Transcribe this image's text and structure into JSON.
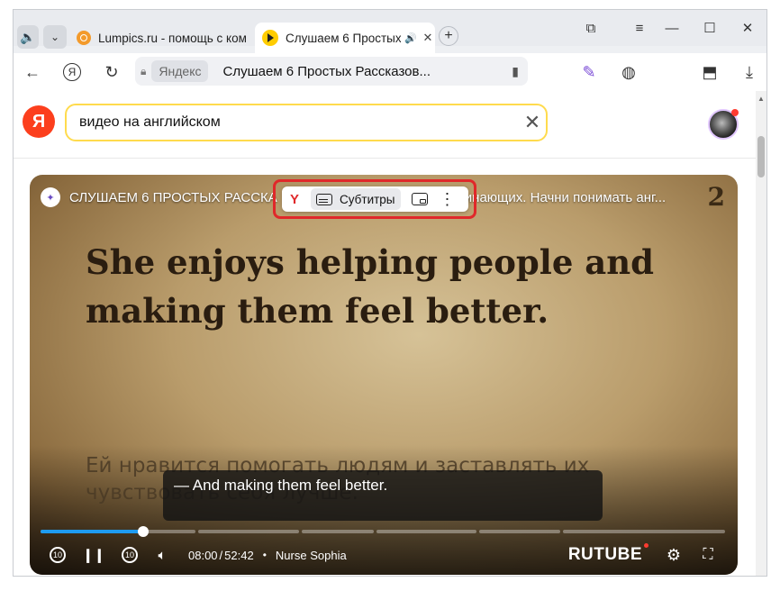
{
  "browser": {
    "tabs": [
      {
        "title": "Lumpics.ru - помощь с ком",
        "close": "✕"
      },
      {
        "title": "Слушаем 6 Простых",
        "close": "✕",
        "active": true
      }
    ],
    "new_tab": "+",
    "window_controls": {
      "minimize": "—",
      "maximize": "☐",
      "close": "✕"
    }
  },
  "toolbar": {
    "domain": "Яндекс",
    "page_title": "Слушаем 6 Простых Рассказов..."
  },
  "search": {
    "logo": "Я",
    "query": "видео на английском",
    "clear": "✕"
  },
  "video": {
    "title": "СЛУШАЕМ 6 ПРОСТЫХ РАССКА",
    "title_tail": "инающих. Начни понимать анг...",
    "corner_number": "2",
    "verse_en": "She enjoys helping people and making them feel better.",
    "verse_ru": "Ей нравится помогать людям и заставлять их чувствовать себя лучше.",
    "subtitle": "— And making them feel better.",
    "progress": 0.15,
    "time_current": "08:00",
    "time_separator": "/",
    "time_total": "52:42",
    "author": "Nurse Sophia",
    "brand": "RUTUBE",
    "skip_back": "10",
    "skip_forward": "10"
  },
  "pip_toolbar": {
    "subtitles_label": "Субтитры"
  },
  "colors": {
    "yandex_red": "#fc3f1d",
    "search_border": "#ffdb4d",
    "highlight_red": "#e0282a",
    "progress_blue": "#1e9bf0"
  }
}
